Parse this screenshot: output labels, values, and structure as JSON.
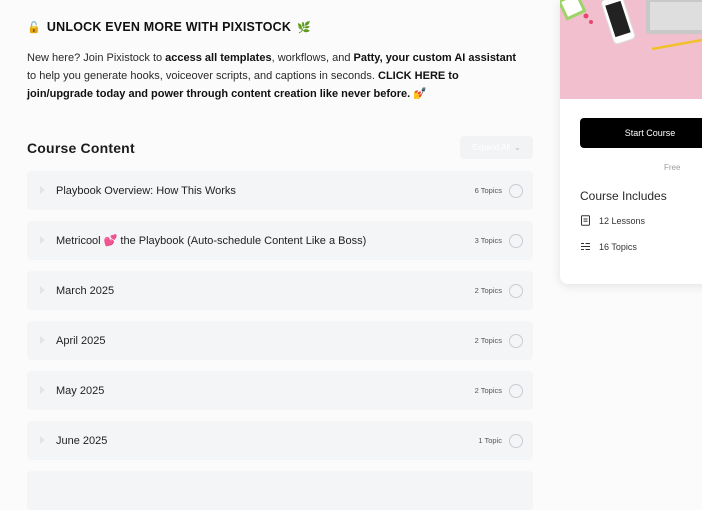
{
  "promo": {
    "lock_emoji": "🔓",
    "title": "UNLOCK EVEN MORE WITH PIXISTOCK",
    "title_emoji": "🌿",
    "text_1": "New here? Join Pixistock to ",
    "bold_1": "access all templates",
    "text_2": ", workflows, and ",
    "bold_2": "Patty, your custom AI assistant",
    "text_3": " to help you generate hooks, voiceover scripts, and captions in seconds. ",
    "bold_3": "CLICK HERE to join/upgrade today and power through content creation like never before.",
    "end_emoji": "💅"
  },
  "course": {
    "title": "Course Content",
    "expand_label": "Expand All",
    "lessons": [
      {
        "title": "Playbook Overview: How This Works",
        "topics": "6 Topics"
      },
      {
        "title": "Metricool 💕 the Playbook (Auto-schedule Content Like a Boss)",
        "topics": "3 Topics"
      },
      {
        "title": "March 2025",
        "topics": "2 Topics"
      },
      {
        "title": "April 2025",
        "topics": "2 Topics"
      },
      {
        "title": "May 2025",
        "topics": "2 Topics"
      },
      {
        "title": "June 2025",
        "topics": "1 Topic"
      }
    ]
  },
  "sidebar": {
    "start_label": "Start Course",
    "price": "Free",
    "includes_title": "Course Includes",
    "lessons_count": "12 Lessons",
    "topics_count": "16 Topics",
    "image_color": "#f2bfcf"
  }
}
